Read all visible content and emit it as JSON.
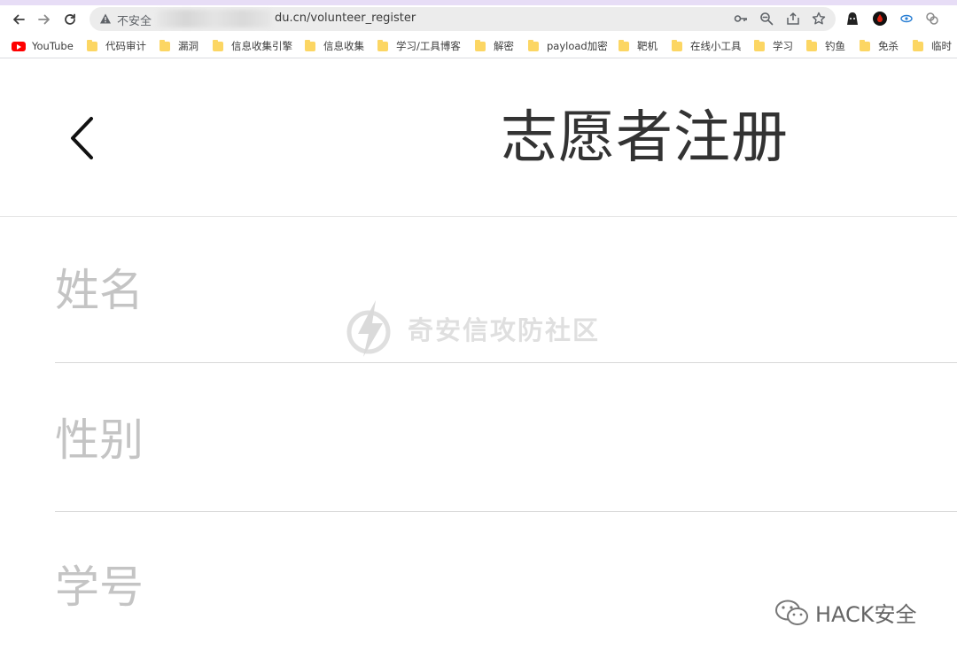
{
  "browser": {
    "address_bar": {
      "security_label": "不安全",
      "url_visible": "du.cn/volunteer_register"
    },
    "bookmarks": [
      {
        "label": "YouTube",
        "icon": "youtube-icon"
      },
      {
        "label": "代码审计",
        "icon": "folder-icon"
      },
      {
        "label": "漏洞",
        "icon": "folder-icon"
      },
      {
        "label": "信息收集引擎",
        "icon": "folder-icon"
      },
      {
        "label": "信息收集",
        "icon": "folder-icon"
      },
      {
        "label": "学习/工具博客",
        "icon": "folder-icon"
      },
      {
        "label": "解密",
        "icon": "folder-icon"
      },
      {
        "label": "payload加密",
        "icon": "folder-icon"
      },
      {
        "label": "靶机",
        "icon": "folder-icon"
      },
      {
        "label": "在线小工具",
        "icon": "folder-icon"
      },
      {
        "label": "学习",
        "icon": "folder-icon"
      },
      {
        "label": "钓鱼",
        "icon": "folder-icon"
      },
      {
        "label": "免杀",
        "icon": "folder-icon"
      },
      {
        "label": "临时",
        "icon": "folder-icon"
      }
    ],
    "colors": {
      "tab_strip": "#e7ddf6",
      "omnibox_bg": "#ececec",
      "folder": "#fcd663"
    }
  },
  "page": {
    "title": "志愿者注册",
    "fields": [
      {
        "label": "姓名"
      },
      {
        "label": "性别"
      },
      {
        "label": "学号"
      }
    ]
  },
  "watermarks": {
    "center": "奇安信攻防社区",
    "corner": "HACK安全"
  }
}
